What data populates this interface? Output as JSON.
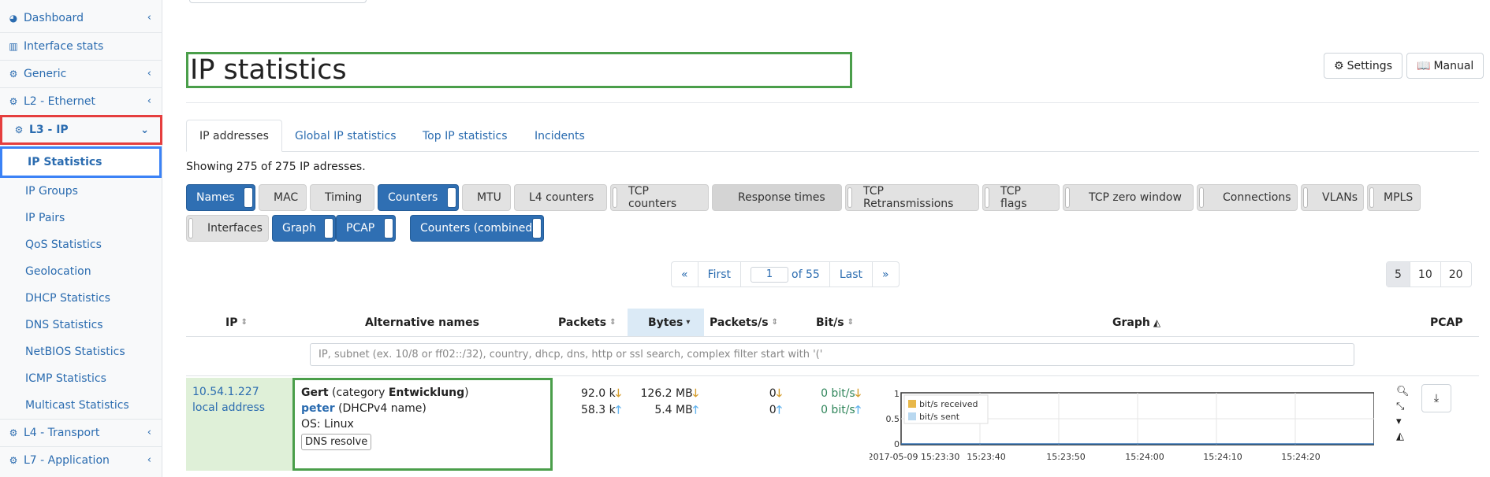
{
  "sidebar": {
    "items": [
      {
        "label": "Dashboard",
        "icon": "dashboard-icon",
        "chev": "‹"
      },
      {
        "label": "Interface stats",
        "icon": "bar-chart-icon",
        "chev": ""
      },
      {
        "label": "Generic",
        "icon": "gear-icon",
        "chev": "‹"
      },
      {
        "label": "L2 - Ethernet",
        "icon": "gear-icon",
        "chev": "‹"
      },
      {
        "label": "L3 - IP",
        "icon": "gear-icon",
        "chev": "⌄"
      }
    ],
    "sub_items": [
      "IP Statistics",
      "IP Groups",
      "IP Pairs",
      "QoS Statistics",
      "Geolocation",
      "DHCP Statistics",
      "DNS Statistics",
      "NetBIOS Statistics",
      "ICMP Statistics",
      "Multicast Statistics"
    ],
    "bottom_items": [
      {
        "label": "L4 - Transport",
        "icon": "gear-icon",
        "chev": "‹"
      },
      {
        "label": "L7 - Application",
        "icon": "gear-icon",
        "chev": "‹"
      }
    ]
  },
  "header": {
    "title": "IP statistics",
    "settings_label": "Settings",
    "manual_label": "Manual"
  },
  "tabs": [
    "IP addresses",
    "Global IP statistics",
    "Top IP statistics",
    "Incidents"
  ],
  "showing_text": "Showing 275 of 275 IP adresses.",
  "toggles_row1": [
    {
      "label": "Names",
      "on": true
    },
    {
      "label": "MAC",
      "on": false
    },
    {
      "label": "Timing",
      "on": false
    },
    {
      "label": "Counters",
      "on": true
    },
    {
      "label": "MTU",
      "on": false
    },
    {
      "label": "L4 counters",
      "on": false
    },
    {
      "label": "TCP counters",
      "on": false
    },
    {
      "label": "Response times",
      "on": false
    },
    {
      "label": "TCP Retransmissions",
      "on": false
    },
    {
      "label": "TCP flags",
      "on": false
    },
    {
      "label": "TCP zero window",
      "on": false
    },
    {
      "label": "Connections",
      "on": false
    },
    {
      "label": "VLANs",
      "on": false
    },
    {
      "label": "MPLS",
      "on": false
    }
  ],
  "toggles_row2": [
    {
      "label": "Interfaces",
      "on": false
    },
    {
      "label": "Graph",
      "on": true
    },
    {
      "label": "PCAP",
      "on": true
    },
    {
      "label": "Counters (combined",
      "on": true
    }
  ],
  "pagination": {
    "prev": "«",
    "first": "First",
    "current": "1",
    "of_text": "of 55",
    "last": "Last",
    "next": "»",
    "sizes": [
      "5",
      "10",
      "20"
    ],
    "selected_size": "5"
  },
  "table": {
    "headers": {
      "ip": "IP",
      "alt": "Alternative names",
      "packets": "Packets",
      "bytes": "Bytes",
      "pps": "Packets/s",
      "bps": "Bit/s",
      "graph": "Graph",
      "pcap": "PCAP"
    },
    "filter_placeholder": "IP, subnet (ex. 10/8 or ff02::/32), country, dhcp, dns, http or ssl search, complex filter start with '('",
    "row": {
      "ip": "10.54.1.227",
      "ip_note": "local address",
      "name": "Gert",
      "category_prefix": "(category ",
      "category": "Entwicklung",
      "category_suffix": ")",
      "dhcp_name": "peter",
      "dhcp_suffix": "(DHCPv4 name)",
      "os": "OS: Linux",
      "dns_button": "DNS resolve",
      "packets_rx": "92.0 k",
      "packets_tx": "58.3 k",
      "bytes_rx": "126.2 MB",
      "bytes_tx": "5.4 MB",
      "pps_rx": "0",
      "pps_tx": "0",
      "bps_rx": "0 bit/s",
      "bps_tx": "0 bit/s"
    },
    "graph": {
      "y_ticks": [
        "1",
        "0.5",
        "0"
      ],
      "x_ticks": [
        "2017-05-09 15:23:30",
        "15:23:40",
        "15:23:50",
        "15:24:00",
        "15:24:10",
        "15:24:20"
      ],
      "legend": [
        {
          "label": "bit/s received",
          "color": "#e8b84a"
        },
        {
          "label": "bit/s sent",
          "color": "#b8d8f0"
        }
      ]
    }
  },
  "colors": {
    "accent": "#2b6cb0",
    "toggle_on": "#2f6fb3",
    "highlight_green": "#4a9e4a",
    "highlight_red": "#e53e3e",
    "highlight_blue": "#3b82f6"
  }
}
